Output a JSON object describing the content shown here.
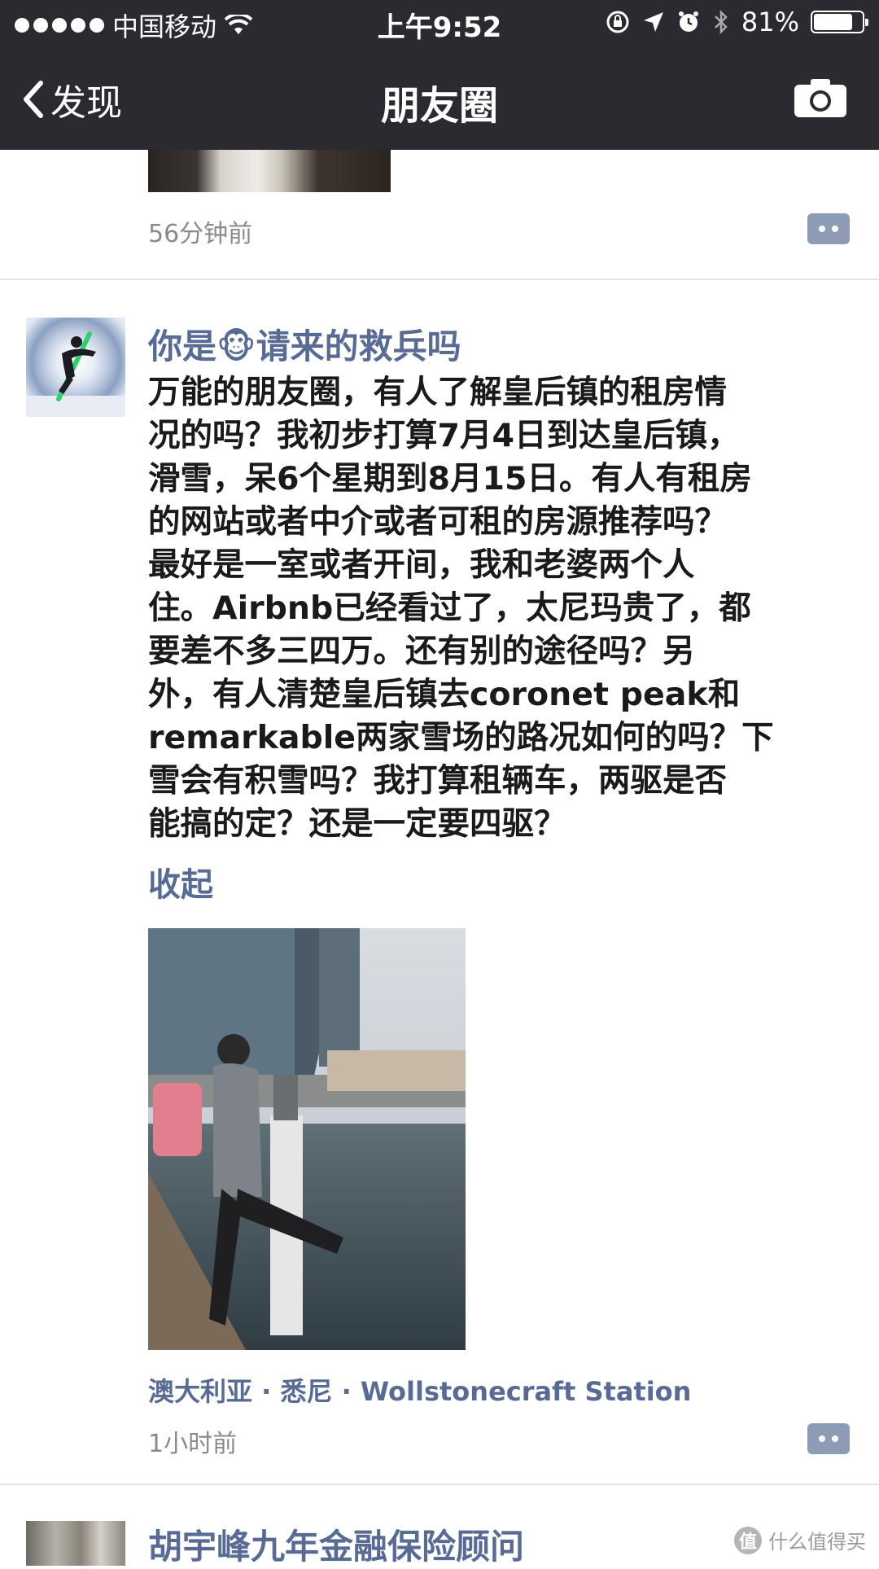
{
  "status_bar": {
    "carrier": "中国移动",
    "time": "上午9:52",
    "battery_percent": "81%",
    "battery_level": 0.81
  },
  "nav": {
    "back_label": "发现",
    "title": "朋友圈",
    "camera_icon": "camera-icon"
  },
  "feed": {
    "previous_post": {
      "time": "56分钟前"
    },
    "post": {
      "author": "你是🐵请来的救兵吗",
      "content": "万能的朋友圈，有人了解皇后镇的租房情\n况的吗？我初步打算7月4日到达皇后镇，\n滑雪，呆6个星期到8月15日。有人有租房\n的网站或者中介或者可租的房源推荐吗？\n最好是一室或者开间，我和老婆两个人\n住。Airbnb已经看过了，太尼玛贵了，都\n要差不多三四万。还有别的途径吗？另\n外，有人清楚皇后镇去coronet peak和\nremarkable两家雪场的路况如何的吗？下\n雪会有积雪吗？我打算租辆车，两驱是否\n能搞的定？还是一定要四驱？",
      "collapse_label": "收起",
      "location": "澳大利亚 · 悉尼 · Wollstonecraft Station",
      "time": "1小时前"
    },
    "next_post": {
      "author": "胡宇峰九年金融保险顾问"
    }
  },
  "watermark": {
    "badge": "值",
    "text": "什么值得买"
  }
}
